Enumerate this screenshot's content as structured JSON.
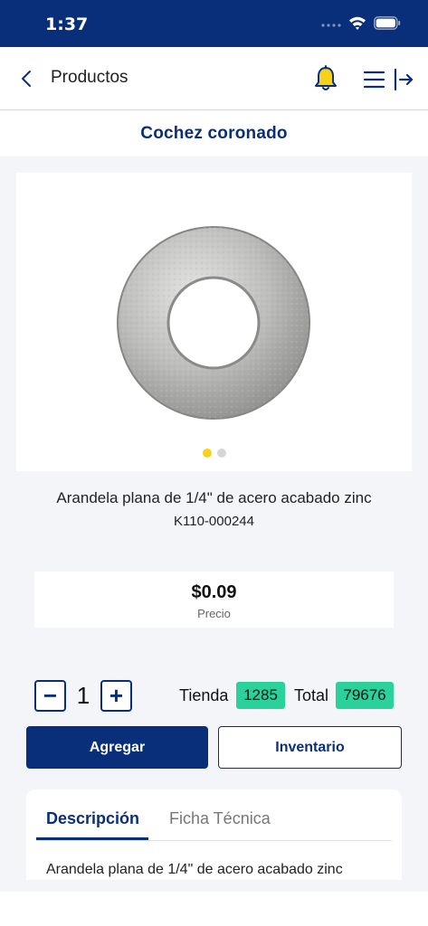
{
  "status_bar": {
    "time": "1:37"
  },
  "nav": {
    "title": "Productos"
  },
  "brand": {
    "name": "Cochez coronado"
  },
  "gallery": {
    "image_icon": "washer-image",
    "dots": 2,
    "active_dot": 0
  },
  "product": {
    "name": "Arandela plana de 1/4\" de acero acabado zinc",
    "sku": "K110-000244"
  },
  "price": {
    "value": "$0.09",
    "label": "Precio"
  },
  "quantity": {
    "minus": "−",
    "value": "1",
    "plus": "+"
  },
  "stock": {
    "store_label": "Tienda",
    "store_value": "1285",
    "total_label": "Total",
    "total_value": "79676"
  },
  "actions": {
    "add_label": "Agregar",
    "inventory_label": "Inventario"
  },
  "tabs": {
    "items": [
      {
        "label": "Descripción"
      },
      {
        "label": "Ficha Técnica"
      }
    ],
    "active": 0,
    "description_text": "Arandela plana de 1/4\" de acero acabado zinc"
  },
  "colors": {
    "brand": "#0a2f7a",
    "accent_yellow": "#f6d21b",
    "stock_badge": "#2ad19a"
  }
}
